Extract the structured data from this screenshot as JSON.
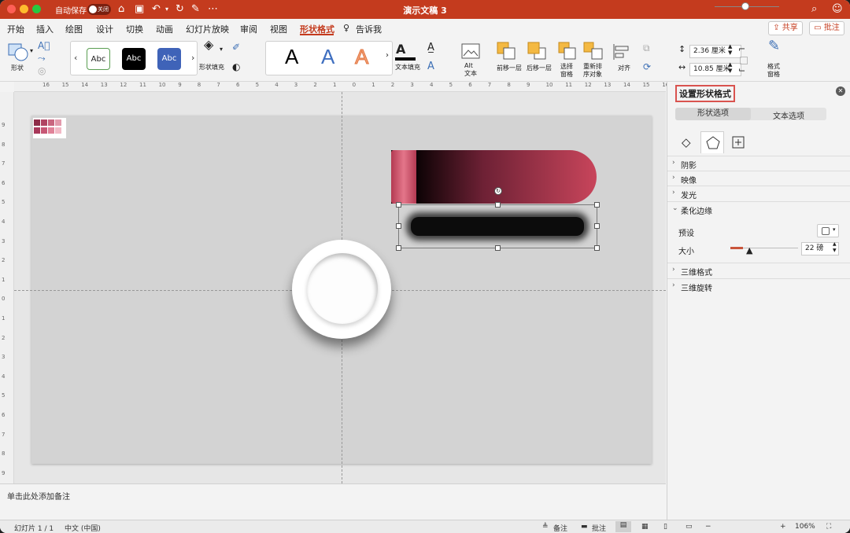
{
  "titlebar": {
    "autosave_label": "自动保存",
    "autosave_state": "关闭",
    "doc_title": "演示文稿 3",
    "bg_color": "#c43b1e"
  },
  "menu": {
    "tabs": [
      "开始",
      "插入",
      "绘图",
      "设计",
      "切换",
      "动画",
      "幻灯片放映",
      "审阅",
      "视图",
      "形状格式"
    ],
    "tell_me": "告诉我",
    "share": "共享",
    "comments": "批注",
    "active_tab": "形状格式"
  },
  "ribbon": {
    "shapes_label": "形状",
    "style_samples": [
      "Abc",
      "Abc",
      "Abc"
    ],
    "shape_fill_label": "形状填充",
    "wordart_samples": [
      "A",
      "A",
      "A"
    ],
    "text_fill_label": "文本填充",
    "alt_text_line1": "Alt",
    "alt_text_line2": "文本",
    "bring_forward": "前移一层",
    "send_backward": "后移一层",
    "selection_pane_line1": "选择",
    "selection_pane_line2": "窗格",
    "reorder_line1": "重新排",
    "reorder_line2": "序对象",
    "align": "对齐",
    "height_value": "2.36 厘米",
    "width_value": "10.85 厘米",
    "format_pane_line1": "格式",
    "format_pane_line2": "窗格"
  },
  "ruler": {
    "h_ticks": [
      "16",
      "15",
      "14",
      "13",
      "12",
      "11",
      "10",
      "9",
      "8",
      "7",
      "6",
      "5",
      "4",
      "3",
      "2",
      "1",
      "0",
      "1",
      "2",
      "3",
      "4",
      "5",
      "6",
      "7",
      "8",
      "9",
      "10",
      "11",
      "12",
      "13",
      "14",
      "15",
      "16"
    ],
    "v_ticks": [
      "9",
      "8",
      "7",
      "6",
      "5",
      "4",
      "3",
      "2",
      "1",
      "0",
      "1",
      "2",
      "3",
      "4",
      "5",
      "6",
      "7",
      "8",
      "9"
    ]
  },
  "palette_colors": [
    "#8e2c48",
    "#b04462",
    "#c9667f",
    "#e39aac",
    "#a8385a",
    "#c75775",
    "#e08399",
    "#f2b9c6"
  ],
  "notes": {
    "placeholder": "单击此处添加备注"
  },
  "status": {
    "slide_count": "幻灯片 1 / 1",
    "language": "中文 (中国)",
    "notes_label": "备注",
    "comments_label": "批注",
    "zoom_pct": "106%"
  },
  "pane": {
    "title": "设置形状格式",
    "tab_shape": "形状选项",
    "tab_text": "文本选项",
    "sections": {
      "shadow": "阴影",
      "reflection": "映像",
      "glow": "发光",
      "soft_edges": "柔化边缘",
      "format_3d": "三维格式",
      "rotation_3d": "三维旋转"
    },
    "preset_label": "预设",
    "size_label": "大小",
    "size_value": "22 磅"
  }
}
